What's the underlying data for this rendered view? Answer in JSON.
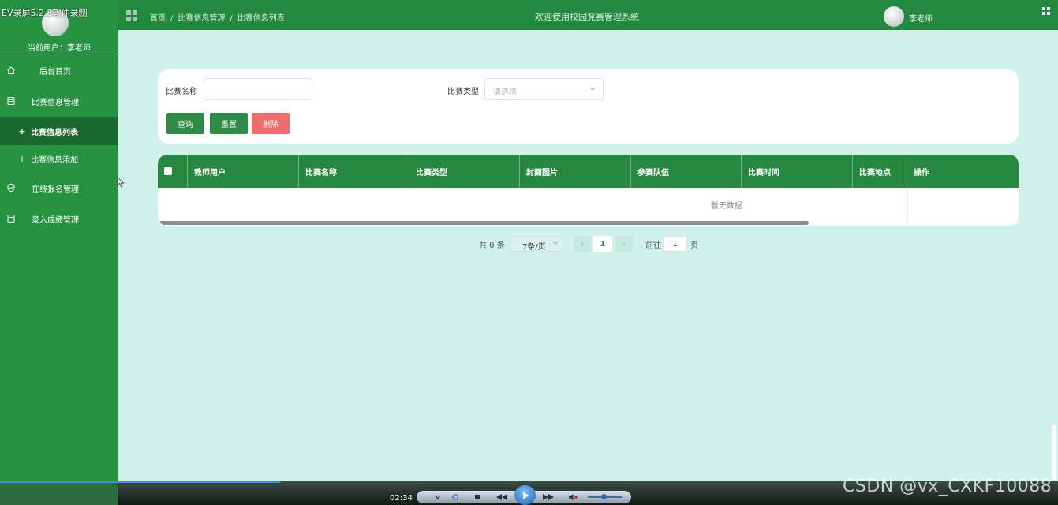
{
  "recorder": {
    "title": "EV录屏5.2.8软件录制",
    "time": "02:34",
    "watermark": "CSDN @vx_CXKF10088"
  },
  "sidebar": {
    "current_user": "当前用户：李老师",
    "items": [
      {
        "label": "后台首页",
        "icon": "home-icon"
      },
      {
        "label": "比赛信息管理",
        "icon": "document-icon"
      },
      {
        "label": "比赛信息列表",
        "icon": "plus-icon",
        "active": true
      },
      {
        "label": "比赛信息添加",
        "icon": "plus-icon"
      },
      {
        "label": "在线报名管理",
        "icon": "shield-icon"
      },
      {
        "label": "录入成绩管理",
        "icon": "document-icon"
      }
    ]
  },
  "header": {
    "breadcrumb": [
      "首页",
      "比赛信息管理",
      "比赛信息列表"
    ],
    "breadcrumb_sep": "/",
    "system_title": "欢迎使用校园竞赛管理系统",
    "user": "李老师"
  },
  "search": {
    "name_label": "比赛名称",
    "name_value": "",
    "type_label": "比赛类型",
    "type_placeholder": "请选择",
    "query_button": "查询",
    "reset_button": "重置",
    "delete_button": "删除"
  },
  "table": {
    "columns": [
      "教师用户",
      "比赛名称",
      "比赛类型",
      "封面图片",
      "参赛队伍",
      "比赛时间",
      "比赛地点",
      "操作"
    ],
    "rows": [],
    "empty_text": "暂无数据"
  },
  "pagination": {
    "total": "共 0 条",
    "page_size": "7条/页",
    "prev": "‹",
    "current": "1",
    "next": "›",
    "goto_label": "前往",
    "goto_value": "1",
    "page_suffix": "页"
  },
  "colors": {
    "sidebar": "#279242",
    "header": "#23893e",
    "table_header": "#26883e",
    "background": "#d0f2ea",
    "delete_button": "#f06b6b"
  }
}
